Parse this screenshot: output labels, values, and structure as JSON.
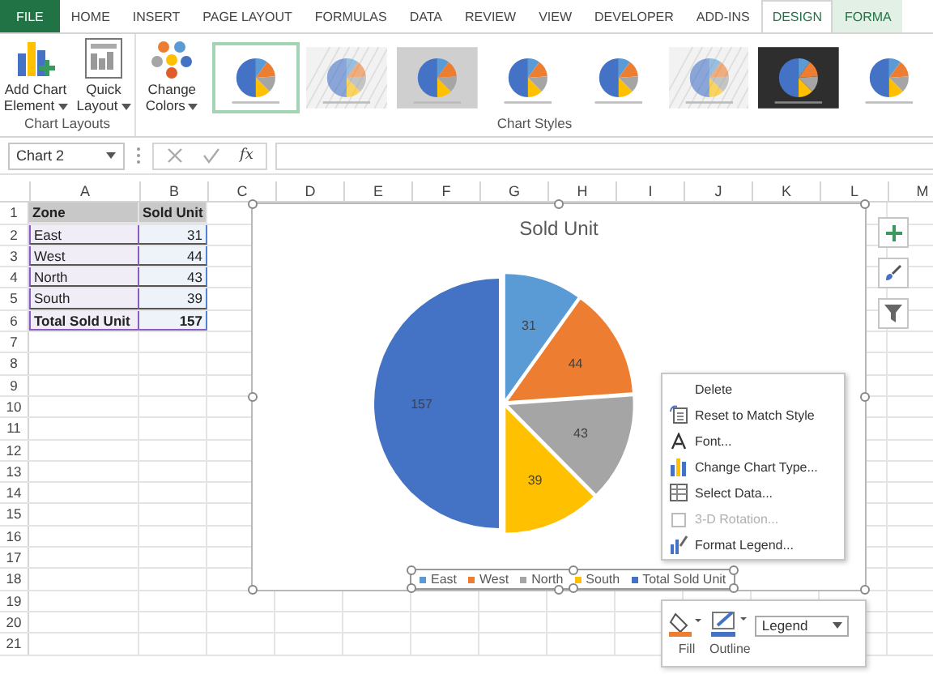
{
  "ribbon": {
    "tabs": [
      {
        "label": "FILE",
        "kind": "file",
        "selected": false
      },
      {
        "label": "HOME",
        "kind": "tab",
        "selected": false
      },
      {
        "label": "INSERT",
        "kind": "tab",
        "selected": false
      },
      {
        "label": "PAGE LAYOUT",
        "kind": "tab",
        "selected": false
      },
      {
        "label": "FORMULAS",
        "kind": "tab",
        "selected": false
      },
      {
        "label": "DATA",
        "kind": "tab",
        "selected": false
      },
      {
        "label": "REVIEW",
        "kind": "tab",
        "selected": false
      },
      {
        "label": "VIEW",
        "kind": "tab",
        "selected": false
      },
      {
        "label": "DEVELOPER",
        "kind": "tab",
        "selected": false
      },
      {
        "label": "ADD-INS",
        "kind": "tab",
        "selected": false
      },
      {
        "label": "DESIGN",
        "kind": "context",
        "selected": true
      },
      {
        "label": "FORMA",
        "kind": "context",
        "selected": false
      }
    ],
    "chart_layouts": {
      "label": "Chart Layouts",
      "add_chart_element": "Add Chart Element",
      "quick_layout": "Quick Layout"
    },
    "chart_styles": {
      "label": "Chart Styles",
      "change_colors": "Change Colors",
      "styles": [
        {
          "kind": "plain",
          "selected": true
        },
        {
          "kind": "hatched",
          "selected": false
        },
        {
          "kind": "gray",
          "selected": false
        },
        {
          "kind": "plain",
          "selected": false
        },
        {
          "kind": "plain",
          "selected": false
        },
        {
          "kind": "hatched",
          "selected": false
        },
        {
          "kind": "dark",
          "selected": false
        },
        {
          "kind": "plain",
          "selected": false
        }
      ]
    }
  },
  "formula_bar": {
    "name_box": "Chart 2",
    "function": "fx"
  },
  "sheet": {
    "columns": [
      "A",
      "B",
      "C",
      "D",
      "E",
      "F",
      "G",
      "H",
      "I",
      "J",
      "K",
      "L",
      "M"
    ],
    "rows": [
      {
        "number": "1",
        "kind": "header",
        "cells": [
          "Zone",
          "Sold Unit"
        ]
      },
      {
        "number": "2",
        "kind": "data",
        "cells": [
          "East",
          "31"
        ]
      },
      {
        "number": "3",
        "kind": "data",
        "cells": [
          "West",
          "44"
        ]
      },
      {
        "number": "4",
        "kind": "data",
        "cells": [
          "North",
          "43"
        ]
      },
      {
        "number": "5",
        "kind": "data",
        "cells": [
          "South",
          "39"
        ]
      },
      {
        "number": "6",
        "kind": "total",
        "cells": [
          "Total Sold Unit",
          "157"
        ]
      },
      {
        "number": "7"
      },
      {
        "number": "8"
      },
      {
        "number": "9"
      },
      {
        "number": "10"
      },
      {
        "number": "11"
      },
      {
        "number": "12"
      },
      {
        "number": "13"
      },
      {
        "number": "14"
      },
      {
        "number": "15"
      },
      {
        "number": "16"
      },
      {
        "number": "17"
      },
      {
        "number": "18"
      },
      {
        "number": "19"
      },
      {
        "number": "20"
      },
      {
        "number": "21"
      }
    ]
  },
  "chart": {
    "chart_data": {
      "type": "pie",
      "title": "Sold Unit",
      "categories": [
        "East",
        "West",
        "North",
        "South",
        "Total Sold Unit"
      ],
      "values": [
        31,
        44,
        43,
        39,
        157
      ],
      "data_labels": true
    },
    "legend": {
      "selected": true,
      "items": [
        {
          "color": "#5b9bd5"
        },
        {
          "color": "#ed7d31"
        },
        {
          "color": "#a5a5a5"
        },
        {
          "color": "#ffc000"
        },
        {
          "color": "#4472c4"
        }
      ]
    }
  },
  "context_menu": {
    "items": [
      {
        "label": "Delete",
        "kind": "none",
        "disabled": false
      },
      {
        "label": "Reset to Match Style",
        "kind": "reset",
        "disabled": false
      },
      {
        "label": "Font...",
        "kind": "font",
        "disabled": false
      },
      {
        "label": "Change Chart Type...",
        "kind": "charttype",
        "disabled": false
      },
      {
        "label": "Select Data...",
        "kind": "data",
        "disabled": false
      },
      {
        "label": "3-D Rotation...",
        "kind": "rotation",
        "disabled": true
      },
      {
        "label": "Format Legend...",
        "kind": "format",
        "disabled": false
      }
    ]
  },
  "mini_toolbar": {
    "fill": "Fill",
    "outline": "Outline",
    "element": "Legend"
  }
}
